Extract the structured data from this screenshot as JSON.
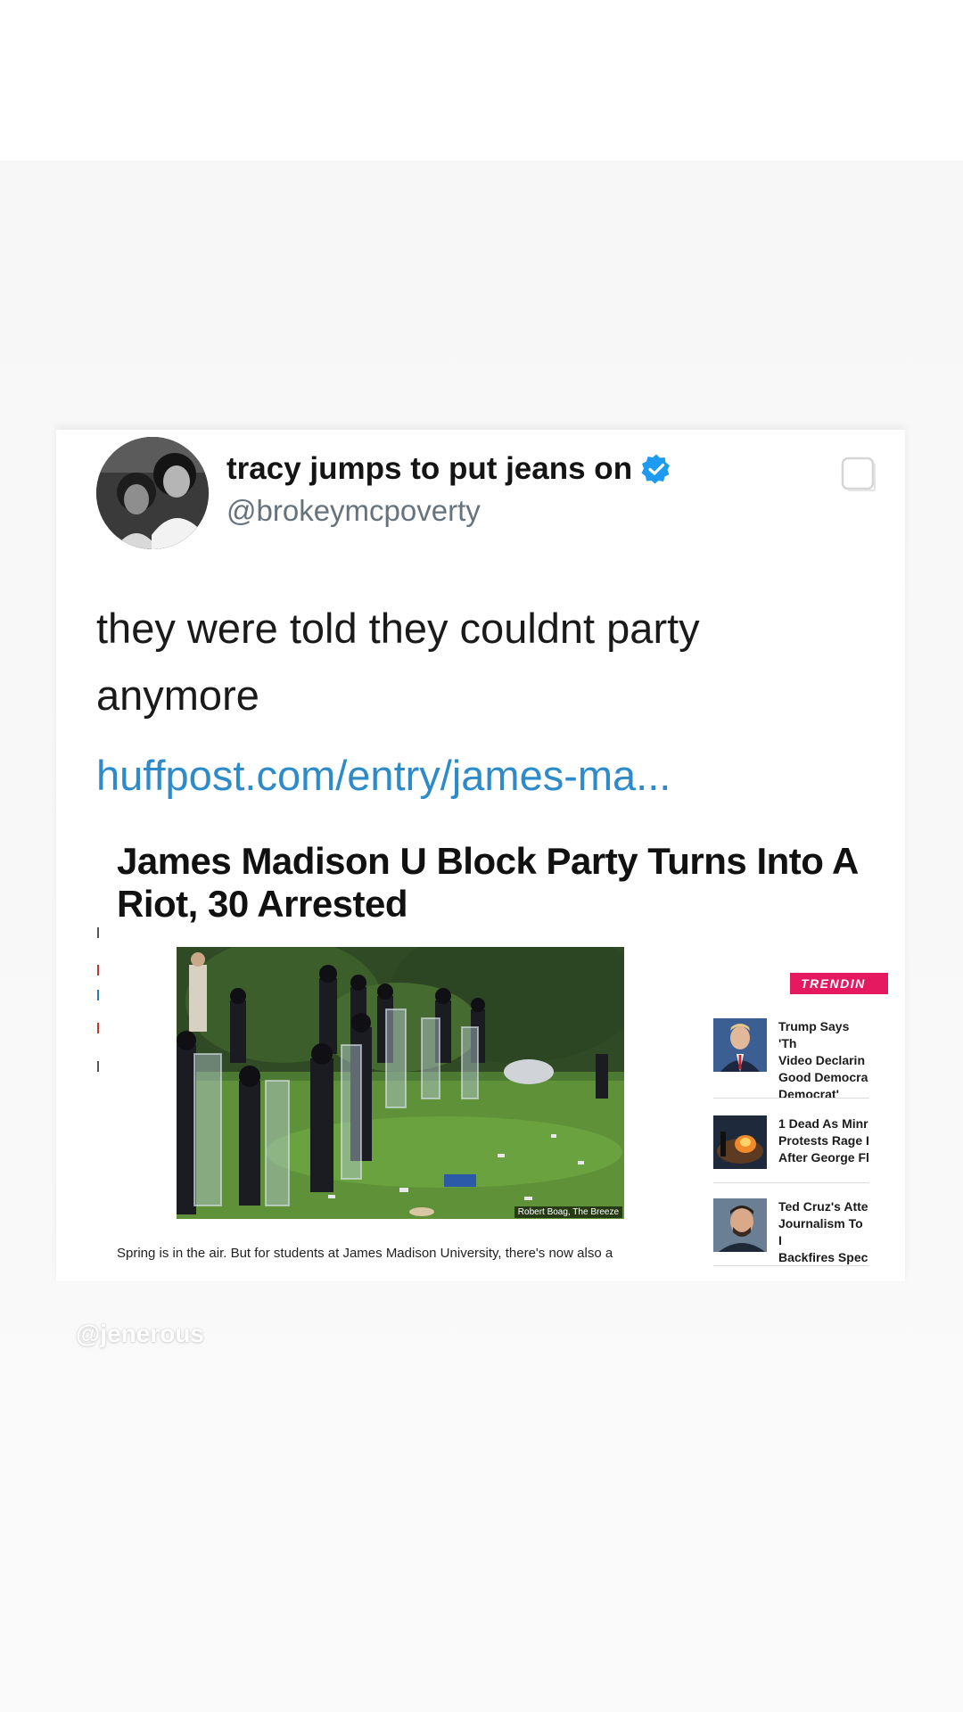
{
  "tweet": {
    "display_name": "tracy jumps to put jeans on",
    "handle": "@brokeymcpoverty",
    "verified": true,
    "verified_icon": "verified-badge-icon",
    "text": "they were told they couldnt party anymore",
    "link": "huffpost.com/entry/james-ma...",
    "link_color": "#2d8bc9"
  },
  "article": {
    "title": "James Madison U Block Party Turns Into A Riot, 30 Arrested",
    "photo_credit": "Robert Boag, The Breeze",
    "lede": "Spring is in the air. But for students at James Madison University, there's now also a",
    "trending": {
      "label": "TRENDIN",
      "accent_color": "#e5195f",
      "items": [
        {
          "text": "Trump Says 'Th\nVideo Declarin\nGood Democra\nDemocrat'",
          "thumb": "trump-photo"
        },
        {
          "text": "1 Dead As Minr\nProtests Rage I\nAfter George Fl",
          "thumb": "protest-photo"
        },
        {
          "text": "Ted Cruz's Atte\nJournalism To I\nBackfires Spec",
          "thumb": "cruz-photo"
        }
      ]
    }
  },
  "watermark": "@jenerous"
}
